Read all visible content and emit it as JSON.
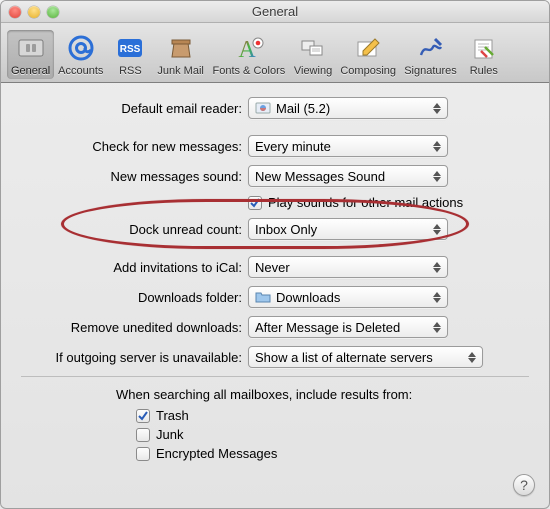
{
  "window": {
    "title": "General"
  },
  "toolbar": {
    "items": [
      {
        "label": "General"
      },
      {
        "label": "Accounts"
      },
      {
        "label": "RSS"
      },
      {
        "label": "Junk Mail"
      },
      {
        "label": "Fonts & Colors"
      },
      {
        "label": "Viewing"
      },
      {
        "label": "Composing"
      },
      {
        "label": "Signatures"
      },
      {
        "label": "Rules"
      }
    ]
  },
  "labels": {
    "default_reader": "Default email reader:",
    "check_messages": "Check for new messages:",
    "sound": "New messages sound:",
    "play_sounds": "Play sounds for other mail actions",
    "dock_count": "Dock unread count:",
    "ical": "Add invitations to iCal:",
    "downloads": "Downloads folder:",
    "remove_downloads": "Remove unedited downloads:",
    "outgoing": "If outgoing server is unavailable:",
    "search_heading": "When searching all mailboxes, include results from:",
    "trash": "Trash",
    "junk": "Junk",
    "encrypted": "Encrypted Messages"
  },
  "values": {
    "default_reader": "Mail (5.2)",
    "check_messages": "Every minute",
    "sound": "New Messages Sound",
    "dock_count": "Inbox Only",
    "ical": "Never",
    "downloads": "Downloads",
    "remove_downloads": "After Message is Deleted",
    "outgoing": "Show a list of alternate servers"
  },
  "checks": {
    "play_sounds": true,
    "trash": true,
    "junk": false,
    "encrypted": false
  },
  "help": "?"
}
